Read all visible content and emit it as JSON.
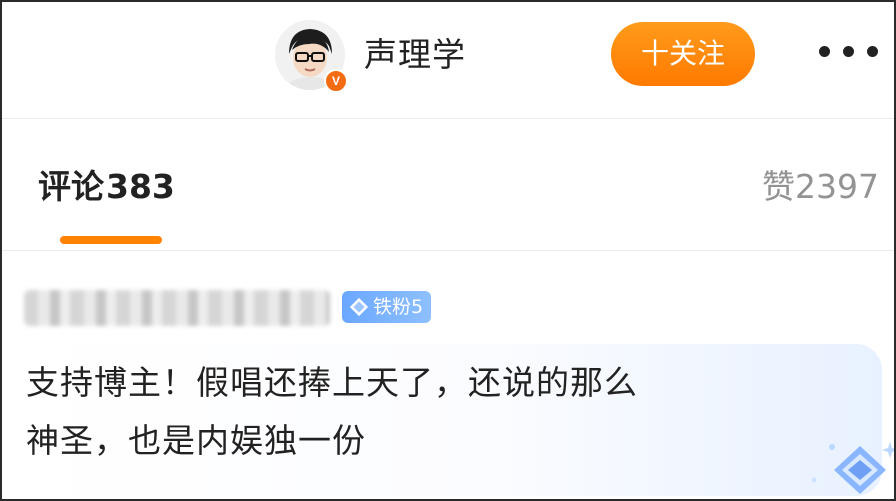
{
  "header": {
    "username": "声理学",
    "verified_badge": "V",
    "follow_label": "十关注",
    "more_icon": "more-dots-icon"
  },
  "tabs": {
    "comments_label": "评论",
    "comments_count": "383",
    "likes_label": "赞",
    "likes_count": "2397",
    "active_color": "#ff8200"
  },
  "comment": {
    "fan_badge": "铁粉5",
    "text_line1": "支持博主！假唱还捧上天了，还说的那么",
    "text_line2": "神圣，也是内娱独一份"
  },
  "colors": {
    "accent": "#ff8a00",
    "badge_blue": "#6aa7ff",
    "verified": "#f36c12"
  }
}
